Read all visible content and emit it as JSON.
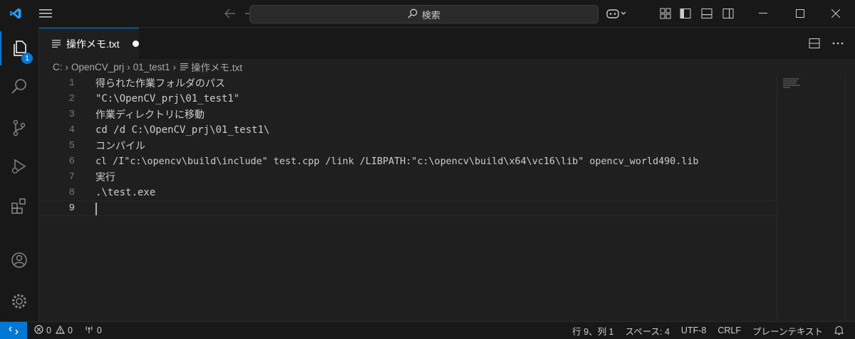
{
  "titlebar": {
    "search_label": "検索"
  },
  "activitybar": {
    "explorer_badge": "1"
  },
  "tab": {
    "filename": "操作メモ.txt"
  },
  "breadcrumb": [
    "C:",
    "OpenCV_prj",
    "01_test1",
    "操作メモ.txt"
  ],
  "editor": {
    "lines": [
      {
        "num": "1",
        "text": "得られた作業フォルダのパス"
      },
      {
        "num": "2",
        "text": "\"C:\\OpenCV_prj\\01_test1\""
      },
      {
        "num": "3",
        "text": "作業ディレクトリに移動"
      },
      {
        "num": "4",
        "text": "cd /d C:\\OpenCV_prj\\01_test1\\"
      },
      {
        "num": "5",
        "text": "コンパイル"
      },
      {
        "num": "6",
        "text": "cl /I\"c:\\opencv\\build\\include\" test.cpp /link /LIBPATH:\"c:\\opencv\\build\\x64\\vc16\\lib\" opencv_world490.lib"
      },
      {
        "num": "7",
        "text": "実行"
      },
      {
        "num": "8",
        "text": ".\\test.exe"
      },
      {
        "num": "9",
        "text": ""
      }
    ]
  },
  "statusbar": {
    "errors": "0",
    "warnings": "0",
    "ports": "0",
    "position": "行 9、列 1",
    "spaces": "スペース: 4",
    "encoding": "UTF-8",
    "eol": "CRLF",
    "language": "プレーンテキスト"
  },
  "colors": {
    "accent": "#0078d4",
    "background": "#1f1f1f"
  }
}
